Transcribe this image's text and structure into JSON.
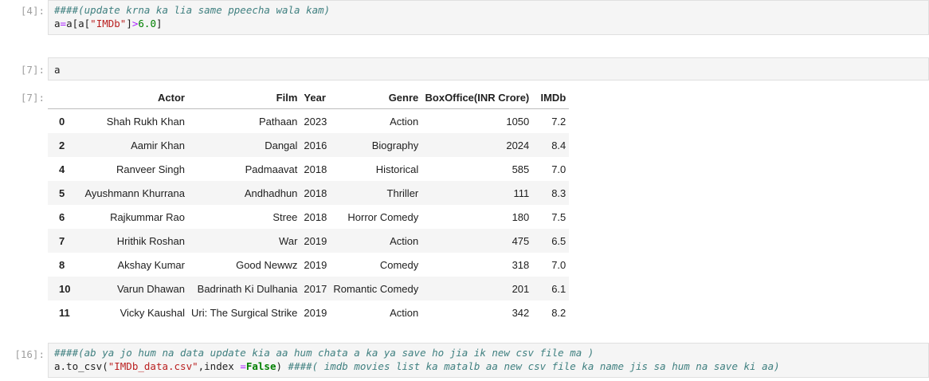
{
  "cells": {
    "c4": {
      "prompt": "[4]:",
      "comment": "####(update krna ka lia same ppeecha wala kam)",
      "code_a": "a",
      "code_eq": "=",
      "code_a2": "a[a[",
      "code_str": "\"IMDb\"",
      "code_close": "]",
      "code_gt": ">",
      "code_num": "6.0",
      "code_end": "]"
    },
    "c7": {
      "prompt_in": "[7]:",
      "code": "a",
      "prompt_out": "[7]:"
    },
    "c16": {
      "prompt": "[16]:",
      "comment": "####(ab ya jo hum na data update kia aa hum chata a ka ya save ho jia ik new csv file ma )",
      "code_pre": "a.to_csv(",
      "code_str": "\"IMDb_data.csv\"",
      "code_mid": ",index ",
      "code_eq": "=",
      "code_kw": "False",
      "code_close": ") ",
      "code_comment": "####( imdb movies list ka matalb aa new csv file ka name jis sa hum na save ki aa)"
    }
  },
  "table": {
    "columns": [
      "",
      "Actor",
      "Film",
      "Year",
      "Genre",
      "BoxOffice(INR Crore)",
      "IMDb"
    ],
    "rows": [
      {
        "idx": "0",
        "actor": "Shah Rukh Khan",
        "film": "Pathaan",
        "year": "2023",
        "genre": "Action",
        "box": "1050",
        "imdb": "7.2"
      },
      {
        "idx": "2",
        "actor": "Aamir Khan",
        "film": "Dangal",
        "year": "2016",
        "genre": "Biography",
        "box": "2024",
        "imdb": "8.4"
      },
      {
        "idx": "4",
        "actor": "Ranveer Singh",
        "film": "Padmaavat",
        "year": "2018",
        "genre": "Historical",
        "box": "585",
        "imdb": "7.0"
      },
      {
        "idx": "5",
        "actor": "Ayushmann Khurrana",
        "film": "Andhadhun",
        "year": "2018",
        "genre": "Thriller",
        "box": "111",
        "imdb": "8.3"
      },
      {
        "idx": "6",
        "actor": "Rajkummar Rao",
        "film": "Stree",
        "year": "2018",
        "genre": "Horror Comedy",
        "box": "180",
        "imdb": "7.5"
      },
      {
        "idx": "7",
        "actor": "Hrithik Roshan",
        "film": "War",
        "year": "2019",
        "genre": "Action",
        "box": "475",
        "imdb": "6.5"
      },
      {
        "idx": "8",
        "actor": "Akshay Kumar",
        "film": "Good Newwz",
        "year": "2019",
        "genre": "Comedy",
        "box": "318",
        "imdb": "7.0"
      },
      {
        "idx": "10",
        "actor": "Varun Dhawan",
        "film": "Badrinath Ki Dulhania",
        "year": "2017",
        "genre": "Romantic Comedy",
        "box": "201",
        "imdb": "6.1"
      },
      {
        "idx": "11",
        "actor": "Vicky Kaushal",
        "film": "Uri: The Surgical Strike",
        "year": "2019",
        "genre": "Action",
        "box": "342",
        "imdb": "8.2"
      }
    ]
  },
  "colors": {
    "comment": "#408080",
    "string": "#ba2121",
    "number": "#008000",
    "operator": "#aa22ff",
    "keyword": "#008000",
    "prompt": "#9e9e9e",
    "cell_bg": "#f5f5f5"
  }
}
